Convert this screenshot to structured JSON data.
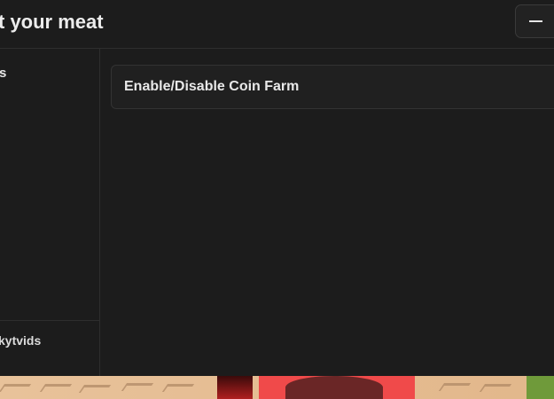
{
  "window": {
    "title": "t your meat",
    "minimize_icon": "minus-icon"
  },
  "sidebar": {
    "active_tab": "ts",
    "username": "kytvids"
  },
  "main": {
    "toggle_label": "Enable/Disable Coin Farm"
  },
  "colors": {
    "panel_bg": "#1c1c1c",
    "card_bg": "#202020",
    "text": "#e8e8e8",
    "border": "#333333"
  }
}
